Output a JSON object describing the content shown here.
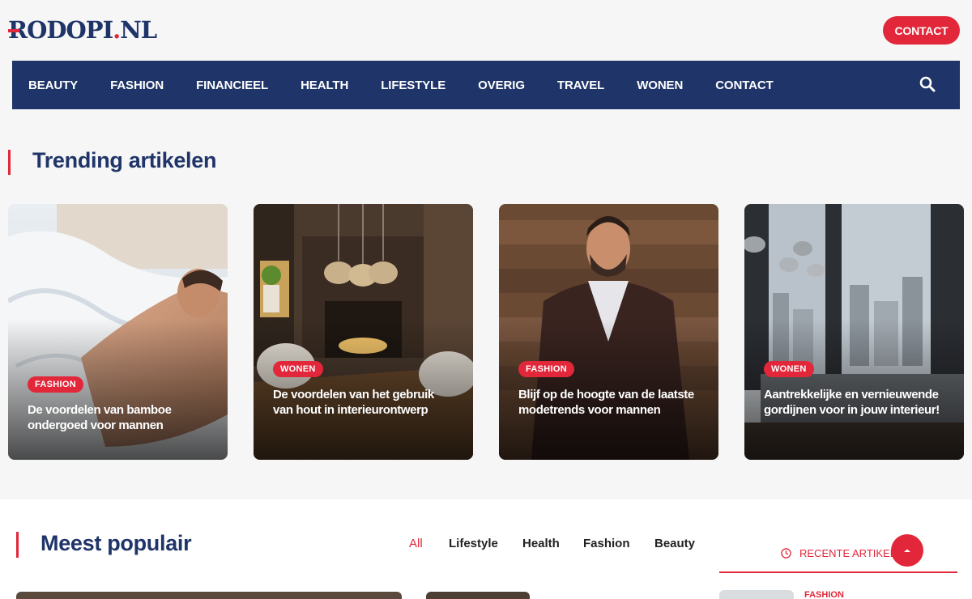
{
  "header": {
    "logo_main": "RODOPI",
    "logo_dot": ".",
    "logo_tld": "NL",
    "contact_label": "CONTACT"
  },
  "nav": {
    "items": [
      "BEAUTY",
      "FASHION",
      "FINANCIEEL",
      "HEALTH",
      "LIFESTYLE",
      "OVERIG",
      "TRAVEL",
      "WONEN",
      "CONTACT"
    ]
  },
  "trending": {
    "title": "Trending artikelen",
    "cards": [
      {
        "category": "FASHION",
        "title": "De voordelen van bamboe ondergoed voor mannen"
      },
      {
        "category": "WONEN",
        "title": "De voordelen van het gebruik van hout in interieurontwerp"
      },
      {
        "category": "FASHION",
        "title": "Blijf op de hoogte van de laatste modetrends voor mannen"
      },
      {
        "category": "WONEN",
        "title": "Aantrekkelijke en vernieuwende gordijnen voor in jouw interieur!"
      }
    ]
  },
  "popular": {
    "title": "Meest populair",
    "filters": [
      "All",
      "Lifestyle",
      "Health",
      "Fashion",
      "Beauty"
    ],
    "active_filter": "All"
  },
  "sidebar": {
    "tab_label": "RECENTE ARTIKELEN",
    "first_category": "FASHION"
  },
  "colors": {
    "brand_navy": "#1f3468",
    "accent_red": "#e2273a"
  }
}
